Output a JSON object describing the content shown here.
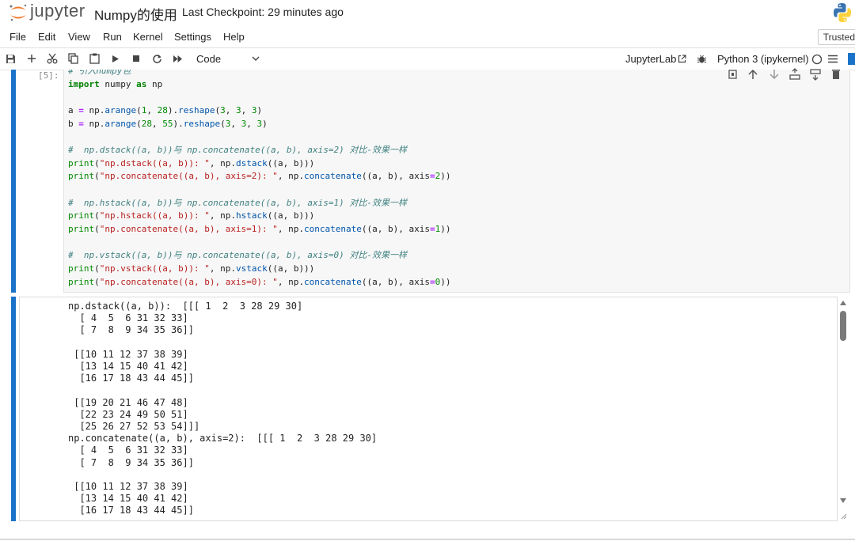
{
  "header": {
    "brand": "jupyter",
    "notebook_title": "Numpy的使用",
    "checkpoint": "Last Checkpoint: 29 minutes ago"
  },
  "menu": [
    "File",
    "Edit",
    "View",
    "Run",
    "Kernel",
    "Settings",
    "Help"
  ],
  "trusted": "Trusted",
  "toolbar": {
    "cell_type": "Code",
    "jupyterlab_label": "JupyterLab",
    "kernel_name": "Python 3 (ipykernel)"
  },
  "cell": {
    "prompt": "[5]:",
    "code": {
      "line1": "# 引入numpy包",
      "line2_kw": "import",
      "line2_rest": " numpy ",
      "line2_as": "as",
      "line2_np": " np",
      "a_line": "a = np.arange(1, 28).reshape(3, 3, 3)",
      "b_line": "b = np.arange(28, 55).reshape(3, 3, 3)",
      "c_dstack": "#  np.dstack((a, b))与 np.concatenate((a, b), axis=2) 对比-效果一样",
      "p_dstack1_str": "\"np.dstack((a, b)): \"",
      "p_dstack2_str": "\"np.concatenate((a, b), axis=2): \"",
      "c_hstack": "#  np.hstack((a, b))与 np.concatenate((a, b), axis=1) 对比-效果一样",
      "p_hstack1_str": "\"np.hstack((a, b)): \"",
      "p_hstack2_str": "\"np.concatenate((a, b), axis=1): \"",
      "c_vstack": "#  np.vstack((a, b))与 np.concatenate((a, b), axis=0) 对比-效果一样",
      "p_vstack1_str": "\"np.vstack((a, b)): \"",
      "p_vstack2_str": "\"np.concatenate((a, b), axis=0): \""
    },
    "output": [
      "np.dstack((a, b)):  [[[ 1  2  3 28 29 30]",
      "  [ 4  5  6 31 32 33]",
      "  [ 7  8  9 34 35 36]]",
      "",
      " [[10 11 12 37 38 39]",
      "  [13 14 15 40 41 42]",
      "  [16 17 18 43 44 45]]",
      "",
      " [[19 20 21 46 47 48]",
      "  [22 23 24 49 50 51]",
      "  [25 26 27 52 53 54]]]",
      "np.concatenate((a, b), axis=2):  [[[ 1  2  3 28 29 30]",
      "  [ 4  5  6 31 32 33]",
      "  [ 7  8  9 34 35 36]]",
      "",
      " [[10 11 12 37 38 39]",
      "  [13 14 15 40 41 42]",
      "  [16 17 18 43 44 45]]"
    ]
  },
  "colors": {
    "accent_bar": "#1a73c8",
    "jupyter_orange": "#f37726"
  }
}
